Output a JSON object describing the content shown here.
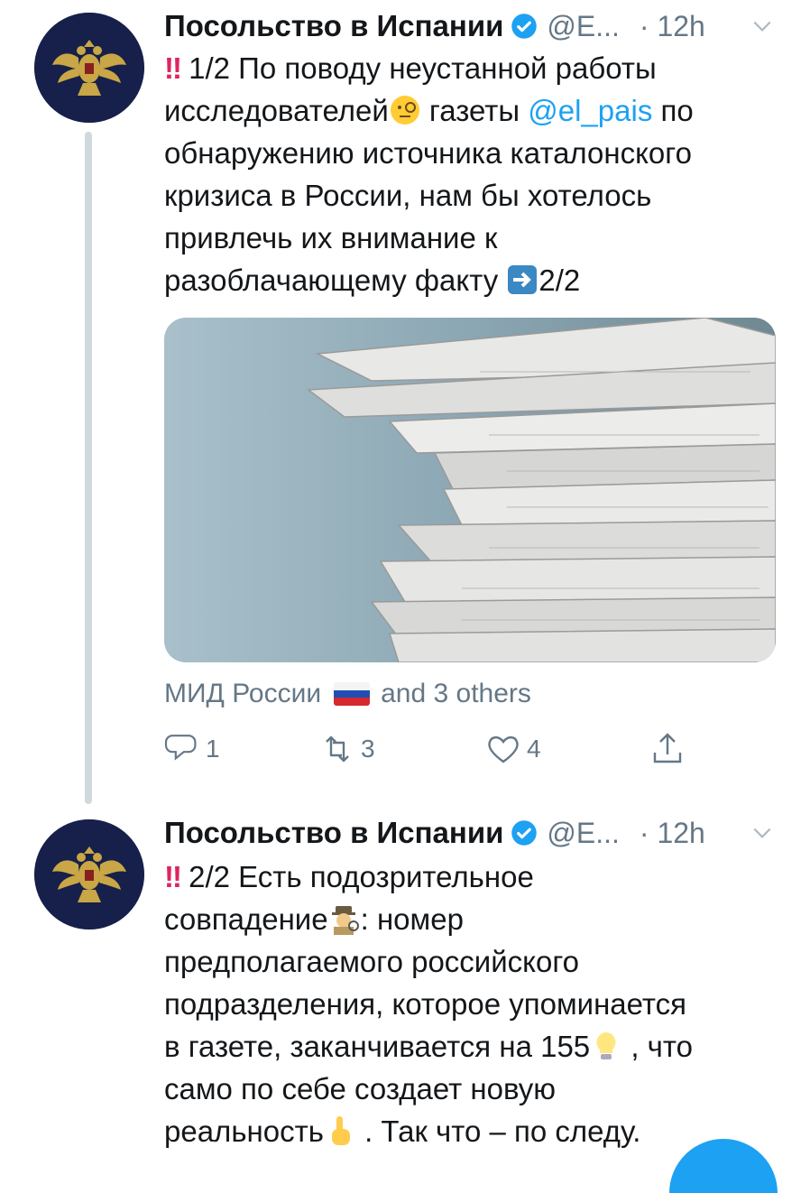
{
  "tweets": [
    {
      "author_name": "Посольство в Испании",
      "handle": "@E...",
      "time": "· 12h",
      "text_lines": [
        {
          "pre": "1/2 По поводу неустанной работы"
        },
        {
          "pre": "исследователей",
          "post_emoji": " газеты ",
          "mention": "@el_pais",
          "post": " по"
        },
        {
          "pre": "обнаружению источника каталонского"
        },
        {
          "pre": "кризиса в России, нам бы хотелось"
        },
        {
          "pre": "привлечь их внимание к"
        },
        {
          "pre": "разоблачающему факту ",
          "post_emoji": "2/2"
        }
      ],
      "liked_by": "МИД России",
      "liked_by_others": "and 3 others",
      "replies": "1",
      "retweets": "3",
      "likes": "4"
    },
    {
      "author_name": "Посольство в Испании",
      "handle": "@E...",
      "time": "· 12h",
      "text_lines": [
        {
          "pre": "2/2 Есть подозрительное"
        },
        {
          "pre": "совпадение",
          "post_emoji": ": номер"
        },
        {
          "pre": "предполагаемого российского"
        },
        {
          "pre": "подразделения, которое упоминается"
        },
        {
          "pre": "в газете, заканчивается на 155",
          "post_emoji": " , что"
        },
        {
          "pre": "само по себе создает новую"
        },
        {
          "pre": "реальность",
          "post_emoji": " . Так что – по следу."
        }
      ]
    }
  ],
  "icons": {
    "verified": "verified-badge-icon",
    "chevron": "chevron-down-icon",
    "reply": "reply-icon",
    "retweet": "retweet-icon",
    "like": "heart-icon",
    "share": "share-icon"
  },
  "colors": {
    "link": "#1da1f2",
    "muted": "#657786",
    "avatar_bg": "#16204a"
  }
}
